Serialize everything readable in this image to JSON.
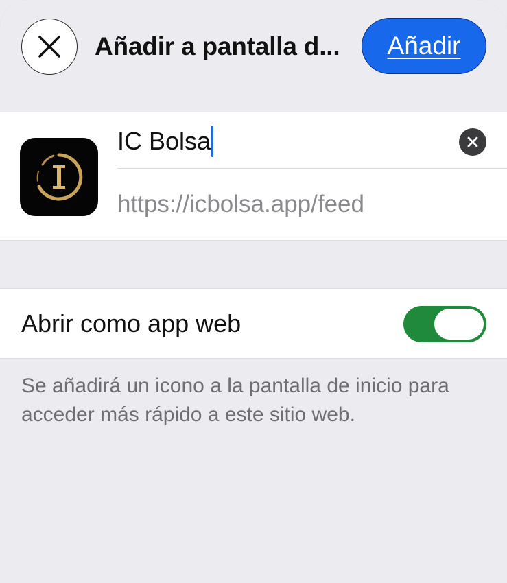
{
  "header": {
    "title": "Añadir a pantalla d...",
    "add_label": "Añadir"
  },
  "bookmark": {
    "name_value": "IC Bolsa",
    "url": "https://icbolsa.app/feed"
  },
  "settings": {
    "open_as_web_app_label": "Abrir como app web",
    "open_as_web_app_enabled": true
  },
  "footnote": "Se añadirá un icono a la pantalla de inicio para acceder más rápido a este sitio web.",
  "colors": {
    "accent_blue": "#1768ea",
    "toggle_on": "#1f8a3b",
    "background": "#ecebf0",
    "icon_gold": "#c9a35a"
  },
  "icons": {
    "close": "close-icon",
    "clear": "clear-text-icon",
    "app": "ic-bolsa-logo-icon"
  }
}
